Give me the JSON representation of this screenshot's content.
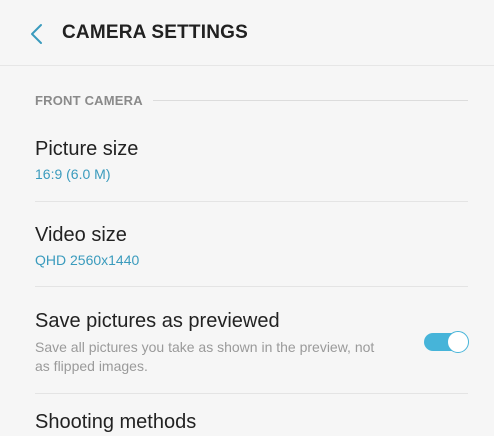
{
  "header": {
    "back_icon": "chevron-left-icon",
    "title": "CAMERA SETTINGS"
  },
  "section": {
    "label": "FRONT CAMERA"
  },
  "settings": [
    {
      "title": "Picture size",
      "value": "16:9 (6.0 M)"
    },
    {
      "title": "Video size",
      "value": "QHD 2560x1440"
    },
    {
      "title": "Save pictures as previewed",
      "description": "Save all pictures you take as shown in the preview, not as flipped images.",
      "toggle_on": true
    },
    {
      "title": "Shooting methods"
    }
  ],
  "colors": {
    "accent": "#46b4d9",
    "value_text": "#3a9bbd",
    "background": "#f6f6f6"
  }
}
